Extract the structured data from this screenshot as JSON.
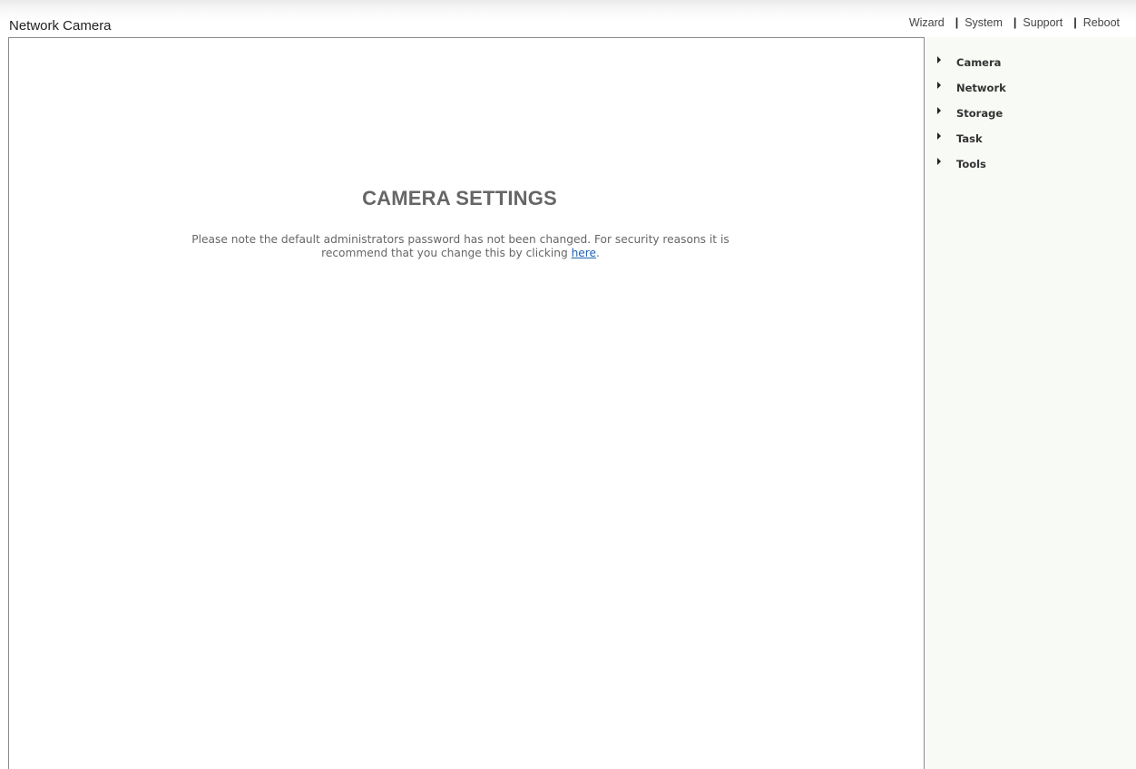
{
  "header": {
    "app_title": "Network Camera",
    "nav": {
      "wizard": "Wizard",
      "system": "System",
      "support": "Support",
      "reboot": "Reboot",
      "separator": "|"
    }
  },
  "main": {
    "heading": "CAMERA SETTINGS",
    "notice_text": "Please note the default administrators password has not been changed. For security reasons it is recommend that you change this by clicking ",
    "notice_link": "here",
    "notice_end": "."
  },
  "sidebar": {
    "items": [
      {
        "label": "Camera",
        "icon": "caret-right-icon"
      },
      {
        "label": "Network",
        "icon": "caret-right-icon"
      },
      {
        "label": "Storage",
        "icon": "caret-right-icon"
      },
      {
        "label": "Task",
        "icon": "caret-right-icon"
      },
      {
        "label": "Tools",
        "icon": "caret-right-icon"
      }
    ]
  },
  "colors": {
    "link": "#1f62b5",
    "heading": "#666666",
    "sidebar_bg": "#f8faf6",
    "frame_border": "#8a8a8a"
  }
}
